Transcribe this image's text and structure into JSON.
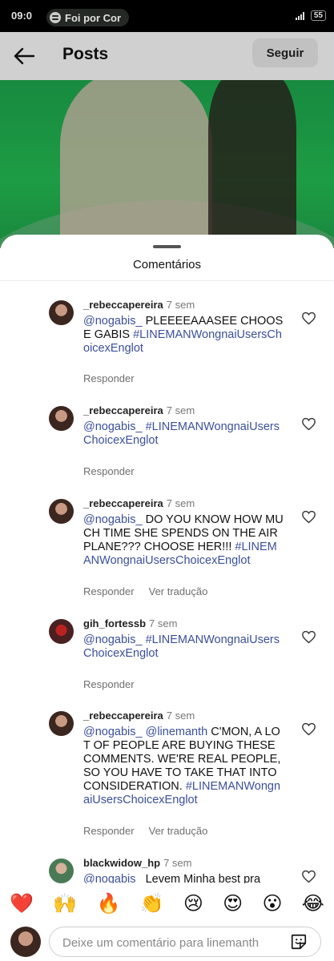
{
  "status_bar": {
    "time": "09:0",
    "spotify_label": "Foi por Cor",
    "battery": "55"
  },
  "header": {
    "title": "Posts",
    "follow_label": "Seguir"
  },
  "sheet": {
    "title": "Comentários"
  },
  "comments": [
    {
      "user": "_rebeccapereira",
      "time": "7 sem",
      "mention": "@nogabis_",
      "text": " PLEEEEAAASEE CHOOSE GABIS ",
      "hashtag": "#LINEMANWongnaiUsersChoicexEnglot",
      "reply_label": "Responder",
      "translate_label": ""
    },
    {
      "user": "_rebeccapereira",
      "time": "7 sem",
      "mention": "@nogabis_",
      "text": " ",
      "hashtag": "#LINEMANWongnaiUsersChoicexEnglot",
      "reply_label": "Responder",
      "translate_label": ""
    },
    {
      "user": "_rebeccapereira",
      "time": "7 sem",
      "mention": "@nogabis_",
      "text": " DO YOU KNOW HOW MUCH TIME SHE SPENDS ON THE AIRPLANE??? CHOOSE HER!!! ",
      "hashtag": "#LINEMANWongnaiUsersChoicexEnglot",
      "reply_label": "Responder",
      "translate_label": "Ver tradução"
    },
    {
      "user": "gih_fortessb",
      "time": "7 sem",
      "mention": "@nogabis_",
      "text": " ",
      "hashtag": "#LINEMANWongnaiUsersChoicexEnglot",
      "reply_label": "Responder",
      "translate_label": ""
    },
    {
      "user": "_rebeccapereira",
      "time": "7 sem",
      "mention": "@nogabis_",
      "mention2": " @linemanth",
      "text": " C'MON, A LOT OF PEOPLE ARE BUYING THESE COMMENTS. WE'RE REAL PEOPLE, SO YOU HAVE TO TAKE THAT INTO CONSIDERATION. ",
      "hashtag": "#LINEMANWongnaiUsersChoicexEnglot",
      "reply_label": "Responder",
      "translate_label": "Ver tradução"
    },
    {
      "user": "blackwidow_hp",
      "time": "7 sem",
      "mention": "@nogabis_",
      "text": "  Levem Minha best pra",
      "hashtag": "",
      "reply_label": "",
      "translate_label": ""
    }
  ],
  "emojis": [
    "❤️",
    "🙌",
    "🔥",
    "👏",
    "😢",
    "😍",
    "😮",
    "😂"
  ],
  "composer": {
    "placeholder": "Deixe um comentário para linemanth"
  },
  "colors": {
    "link": "#3b4f9a",
    "header_bg": "#ededed",
    "image_green": "#22b24f"
  }
}
